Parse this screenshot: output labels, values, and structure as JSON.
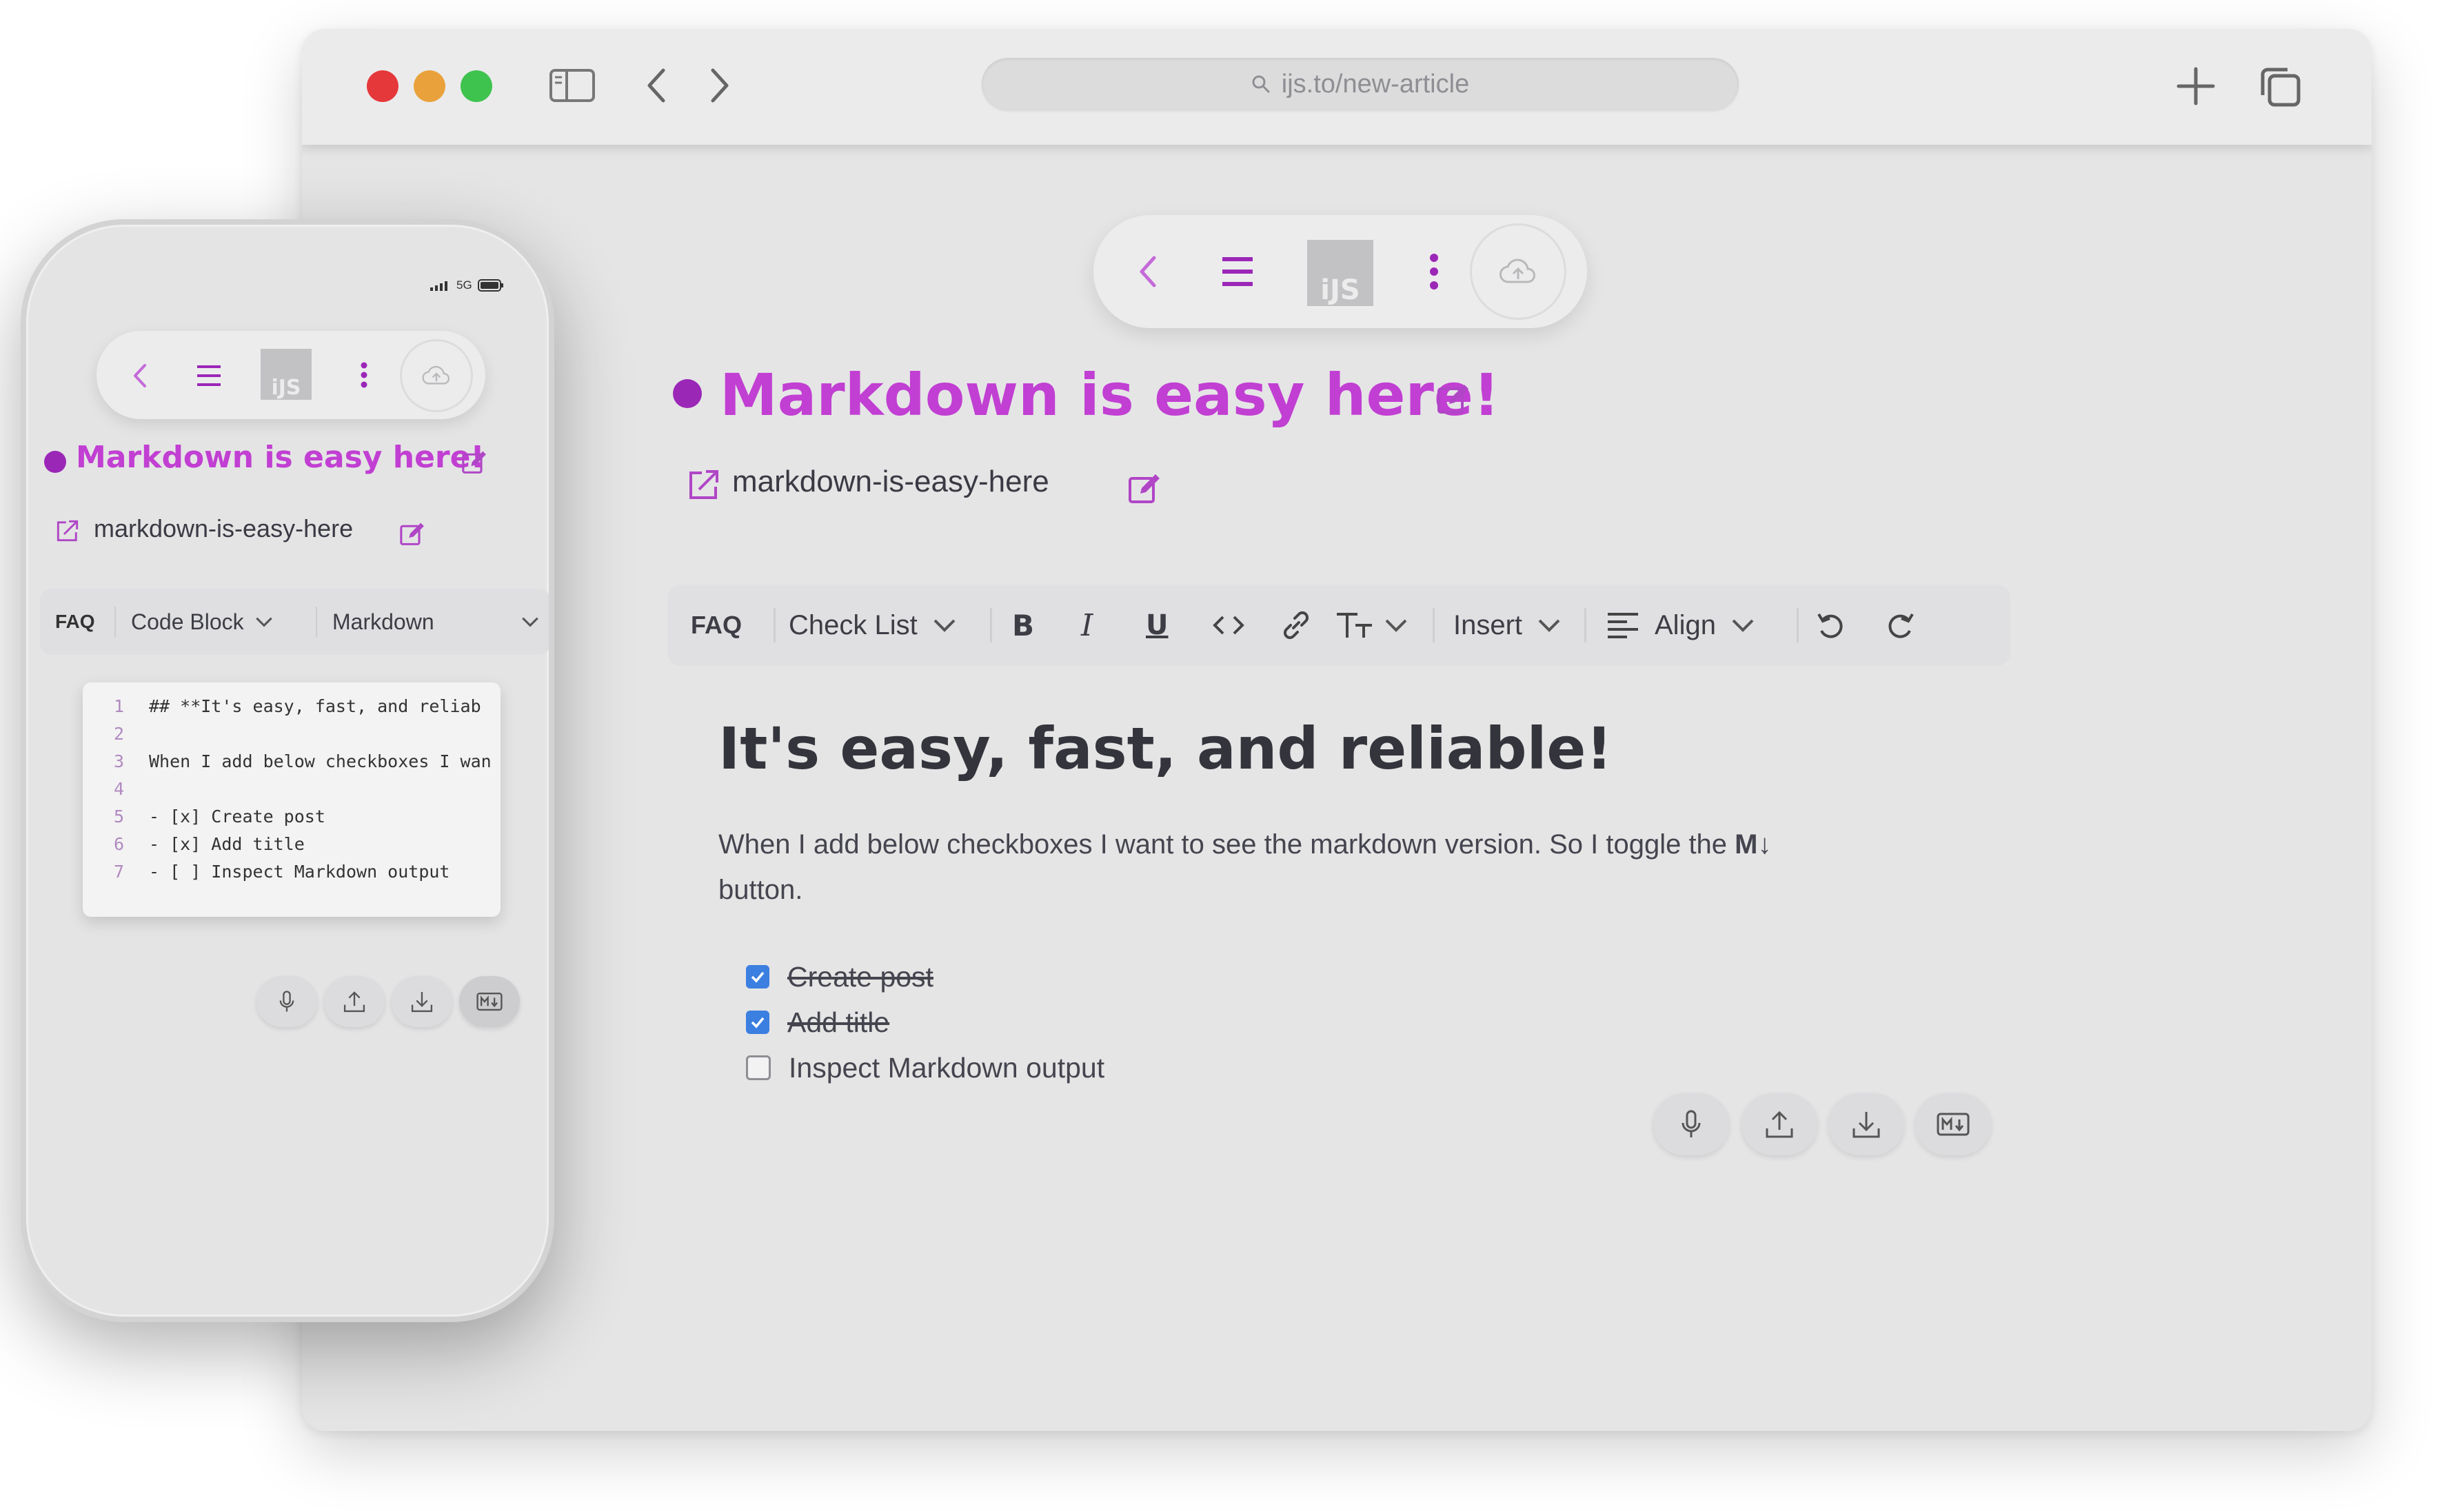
{
  "browser": {
    "url": "ijs.to/new-article",
    "traffic_lights": {
      "close": "#e5383b",
      "minimize": "#e9a23b",
      "zoom": "#3fc34f"
    }
  },
  "app": {
    "logo_text": "iJS",
    "accent_color": "#c13fd2",
    "status_dot_color": "#9b27b7",
    "icons": {
      "back": "chevron-left-icon",
      "menu": "menu-icon",
      "more": "more-vertical-icon",
      "save": "cloud-upload-icon"
    }
  },
  "article": {
    "title": "Markdown is easy here!",
    "slug": "markdown-is-easy-here"
  },
  "toolbar": {
    "faq": "FAQ",
    "block_type": "Check List",
    "insert": "Insert",
    "align": "Align"
  },
  "document": {
    "heading": "It's easy, fast, and reliable!",
    "paragraph": "When I add below checkboxes I want to see the markdown version. So I toggle the ",
    "paragraph_bold": "M↓",
    "paragraph_end": "button.",
    "checklist": [
      {
        "label": "Create post",
        "checked": true
      },
      {
        "label": "Add title",
        "checked": true
      },
      {
        "label": "Inspect Markdown output",
        "checked": false
      }
    ]
  },
  "actions": {
    "icons": [
      "microphone-icon",
      "upload-icon",
      "download-icon",
      "markdown-icon"
    ]
  },
  "phone": {
    "status": {
      "network": "5G"
    },
    "toolbar": {
      "faq": "FAQ",
      "block_type": "Code Block",
      "language": "Markdown"
    },
    "code_lines": [
      {
        "n": "1",
        "text": "## **It's easy, fast, and reliab"
      },
      {
        "n": "2",
        "text": ""
      },
      {
        "n": "3",
        "text": "When I add below checkboxes I wan"
      },
      {
        "n": "4",
        "text": ""
      },
      {
        "n": "5",
        "text": "- [x] Create post"
      },
      {
        "n": "6",
        "text": "- [x] Add title"
      },
      {
        "n": "7",
        "text": "- [ ] Inspect Markdown output"
      }
    ]
  }
}
